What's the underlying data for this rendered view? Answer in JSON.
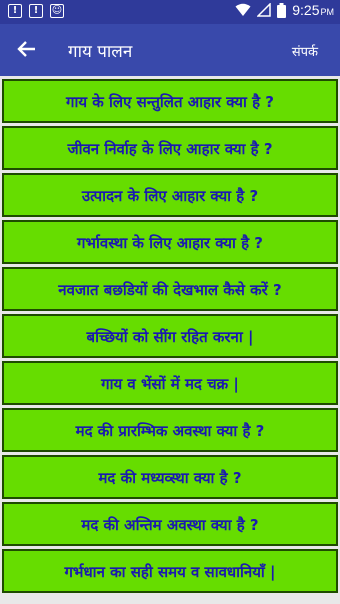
{
  "status_bar": {
    "time": "9:25",
    "ampm": "PM",
    "icons": [
      "notification-icon",
      "alert-icon",
      "android-icon",
      "wifi-icon",
      "no-signal-icon",
      "battery-icon"
    ]
  },
  "app_bar": {
    "back_icon": "back-arrow-icon",
    "title": "गाय पालन",
    "contact_label": "संपर्क"
  },
  "colors": {
    "status_bar": "#2f3a9a",
    "app_bar": "#3949ab",
    "item_bg": "#66dd00",
    "item_text": "#1a1ab0"
  },
  "items": [
    {
      "label": "गाय के लिए सन्तुलित आहार क्या है ?"
    },
    {
      "label": "जीवन निर्वाह के लिए आहार क्या है ?"
    },
    {
      "label": "उत्पादन के लिए आहार क्या है ?"
    },
    {
      "label": "गर्भावस्था के लिए आहार क्या है ?"
    },
    {
      "label": "नवजात बछडियों की देखभाल कैसे करें ?"
    },
    {
      "label": "बच्छियों को सींग रहित करना |"
    },
    {
      "label": "गाय व भेंसों में मद चक्र |"
    },
    {
      "label": "मद की प्रारम्भिक अवस्था क्या है ?"
    },
    {
      "label": "मद की मध्यव्स्था क्या है ?"
    },
    {
      "label": "मद की अन्तिम अवस्था क्या है ?"
    },
    {
      "label": "गर्भधान का सही समय व सावधानियाँ |"
    }
  ]
}
